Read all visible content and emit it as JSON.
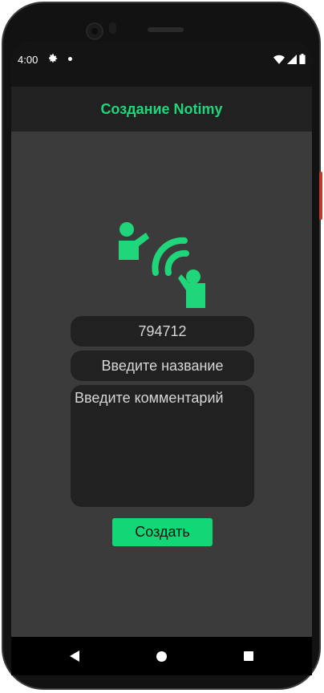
{
  "status_bar": {
    "time": "4:00"
  },
  "app_bar": {
    "title": "Создание Notimy"
  },
  "form": {
    "code_value": "794712",
    "name_placeholder": "Введите название",
    "comment_placeholder": "Введите комментарий",
    "create_button": "Создать"
  },
  "colors": {
    "accent": "#1fd67b",
    "background": "#3b3b3b",
    "field": "#212121",
    "app_bar": "#212121"
  },
  "icons": {
    "status": [
      "gear-icon",
      "notification-dot-icon",
      "wifi-icon",
      "signal-icon",
      "battery-icon"
    ],
    "logo": "people-broadcast-icon",
    "nav": [
      "back-icon",
      "home-icon",
      "recents-icon"
    ]
  }
}
